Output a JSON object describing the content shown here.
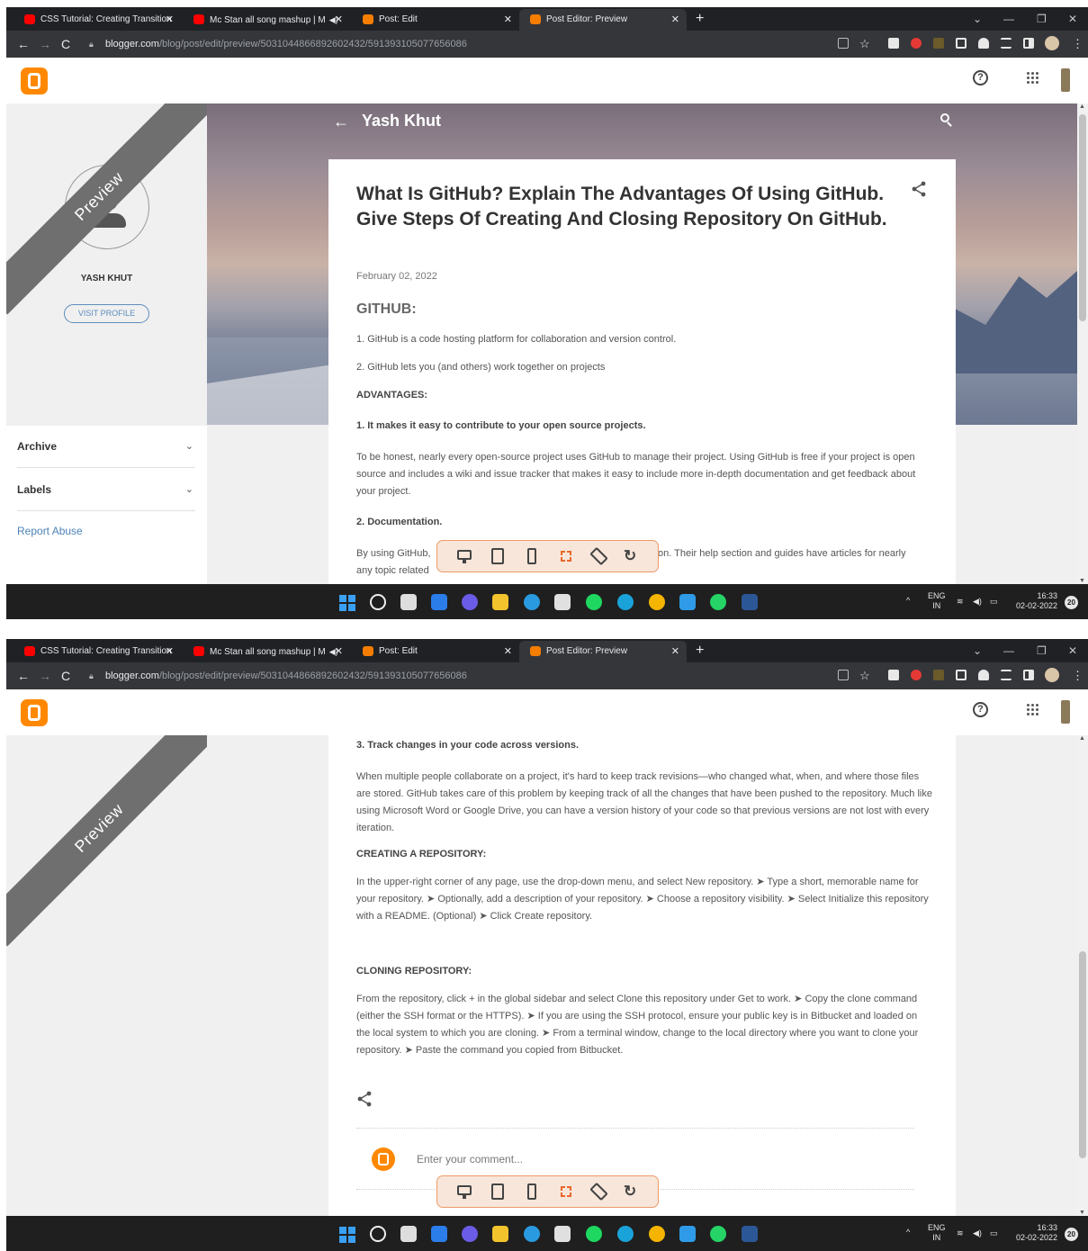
{
  "browser": {
    "tabs": [
      {
        "label": "CSS Tutorial: Creating Transition",
        "icon": "youtube-icon"
      },
      {
        "label": "Mc Stan all song mashup | M",
        "icon": "youtube-icon",
        "sound": true
      },
      {
        "label": "Post: Edit",
        "icon": "blogger-icon"
      },
      {
        "label": "Post Editor: Preview",
        "icon": "blogger-icon",
        "active": true
      }
    ],
    "url_host": "blogger.com",
    "url_path": "/blog/post/edit/preview/5031044866892602432/591393105077656086"
  },
  "sidebar": {
    "ribbon": "Preview",
    "profile_name": "YASH KHUT",
    "visit_profile": "VISIT PROFILE",
    "archive": "Archive",
    "labels": "Labels",
    "report_abuse": "Report Abuse"
  },
  "blog": {
    "title": "Yash Khut"
  },
  "post": {
    "title": "What Is GitHub? Explain The Advantages Of Using GitHub. Give Steps Of Creating And Closing Repository On GitHub.",
    "date": "February 02, 2022",
    "heading_github": "GITHUB:",
    "p1": "1. GitHub is a code hosting platform for collaboration and version control.",
    "p2": "2. GitHub lets you (and others) work together on projects",
    "heading_advantages": "ADVANTAGES:",
    "adv1": "1. It makes it easy to contribute to your open source projects.",
    "adv1_text": "To be honest, nearly every open-source project uses GitHub to manage their project. Using GitHub is free if your project is open source and includes a wiki and issue tracker that makes it easy to include more in-depth documentation and get feedback about your project.",
    "adv2": "2. Documentation.",
    "adv2_text_a": "By using GitHub,",
    "adv2_text_b": "on. Their help section and guides have articles for nearly",
    "adv2_text_c": "any topic related",
    "adv3": "3. Track changes in your code across versions.",
    "adv3_text": "When multiple people collaborate on a project, it's hard to keep track revisions—who changed what, when, and where those files are stored. GitHub takes care of this problem by keeping track of all the changes that have been pushed to the repository. Much like using Microsoft Word or Google Drive, you can have a version history of your code so that previous versions are not lost with every iteration.",
    "heading_creating": "CREATING A REPOSITORY:",
    "creating_text": " In the upper-right corner of any page, use the drop-down menu, and select New repository. ➤ Type a short, memorable name for your repository. ➤  Optionally, add a description of your repository. ➤  Choose a repository visibility. ➤ Select Initialize this repository with a README. (Optional) ➤ Click Create repository.",
    "heading_cloning": "CLONING REPOSITORY:",
    "cloning_text": "From the repository, click + in the global sidebar and select Clone this repository under Get to work. ➤  Copy the clone command (either the SSH format or the HTTPS). ➤  If you are using the SSH protocol, ensure your public key is in Bitbucket and loaded on the local system to which you are cloning. ➤  From a terminal window, change to the local directory where you want to clone your repository. ➤ Paste the command you copied from Bitbucket.",
    "comment_placeholder": "Enter your comment..."
  },
  "taskbar": {
    "lang_top": "ENG",
    "lang_bottom": "IN",
    "time": "16:33",
    "date": "02-02-2022",
    "notifications": "20"
  },
  "colors": {
    "blogger_orange": "#ff8800",
    "link_blue": "#4d83b8",
    "toolbar_border": "#ee9a6a"
  }
}
